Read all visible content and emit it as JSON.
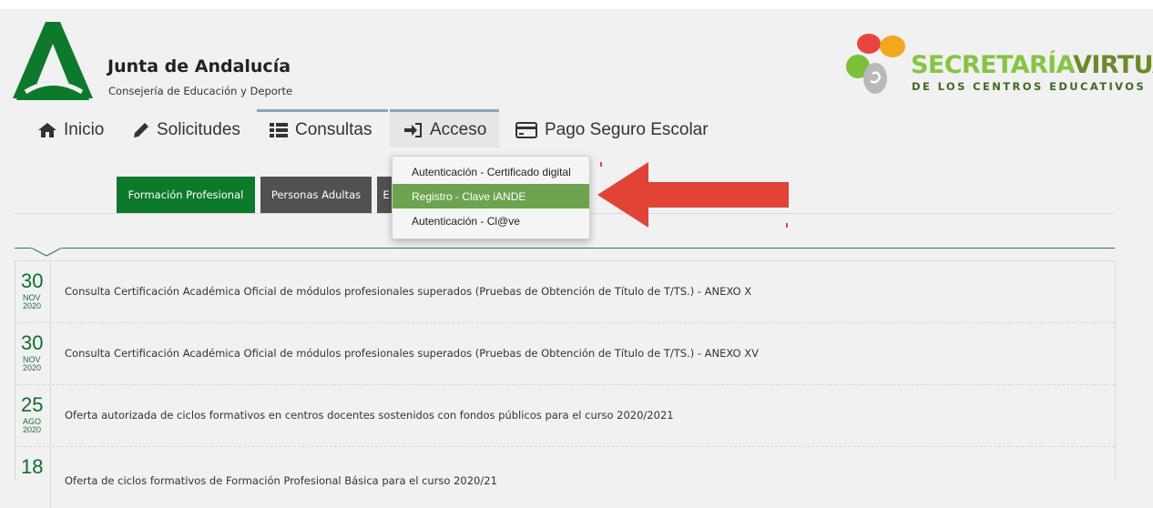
{
  "header": {
    "org_title": "Junta de Andalucía",
    "org_subtitle": "Consejería de Educación y Deporte",
    "sv_title_part1": "SECRETARÍA",
    "sv_title_part2": "VIRTUAL",
    "sv_subtitle": "DE LOS CENTROS EDUCATIVOS"
  },
  "nav": {
    "inicio": "Inicio",
    "solicitudes": "Solicitudes",
    "consultas": "Consultas",
    "acceso": "Acceso",
    "pago": "Pago Seguro Escolar"
  },
  "tabs": {
    "fp": "Formación Profesional",
    "pa": "Personas Adultas",
    "e": "E"
  },
  "dropdown": {
    "items": [
      "Autenticación - Certificado digital",
      "Registro - Clave iANDE",
      "Autenticación - Cl@ve"
    ],
    "active_index": 1
  },
  "news": [
    {
      "day": "30",
      "month": "NOV",
      "year": "2020",
      "text": "Consulta Certificación Académica Oficial de módulos profesionales superados (Pruebas de Obtención de Título de T/TS.) - ANEXO X"
    },
    {
      "day": "30",
      "month": "NOV",
      "year": "2020",
      "text": "Consulta Certificación Académica Oficial de módulos profesionales superados (Pruebas de Obtención de Título de T/TS.) - ANEXO XV"
    },
    {
      "day": "25",
      "month": "AGO",
      "year": "2020",
      "text": "Oferta autorizada de ciclos formativos en centros docentes sostenidos con fondos públicos para el curso 2020/2021"
    },
    {
      "day": "18",
      "month": "",
      "year": "",
      "text": "Oferta de ciclos formativos de Formación Profesional Básica para el curso 2020/21"
    }
  ],
  "colors": {
    "junta_green": "#0d7a2b",
    "tab_dark": "#515151",
    "active_item": "#6ca34f",
    "arrow_red": "#e24336"
  }
}
